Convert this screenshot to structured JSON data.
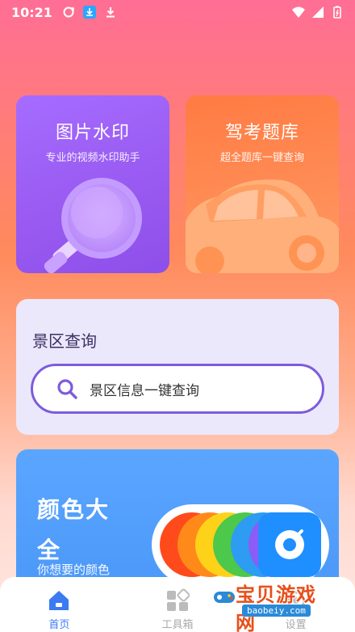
{
  "status_bar": {
    "time": "10:21",
    "icons_left": [
      "sync-icon",
      "download-badge-icon",
      "download-icon"
    ],
    "icons_right": [
      "wifi-icon",
      "signal-icon",
      "battery-icon"
    ]
  },
  "cards": {
    "watermark": {
      "title": "图片水印",
      "subtitle": "专业的视频水印助手"
    },
    "exam": {
      "title": "驾考题库",
      "subtitle": "超全题库一键查询"
    }
  },
  "scenic": {
    "title": "景区查询",
    "search_placeholder": "景区信息一键查询"
  },
  "color_card": {
    "title": "颜色大全",
    "subtitle": "你想要的颜色",
    "swatch_colors": [
      "#ff4a1c",
      "#ff8a1a",
      "#ffd21a",
      "#4cc84a",
      "#2d9cf2",
      "#8b5cf6"
    ]
  },
  "bottom_nav": {
    "items": [
      {
        "label": "首页",
        "active": true
      },
      {
        "label": "工具箱",
        "active": false
      },
      {
        "label": "设置",
        "active": false
      }
    ]
  },
  "watermark_badge": {
    "text": "宝贝游戏网",
    "url": "baobeiy.com"
  },
  "colors": {
    "accent_blue": "#3a7bf2",
    "search_border": "#7d5cdc"
  }
}
